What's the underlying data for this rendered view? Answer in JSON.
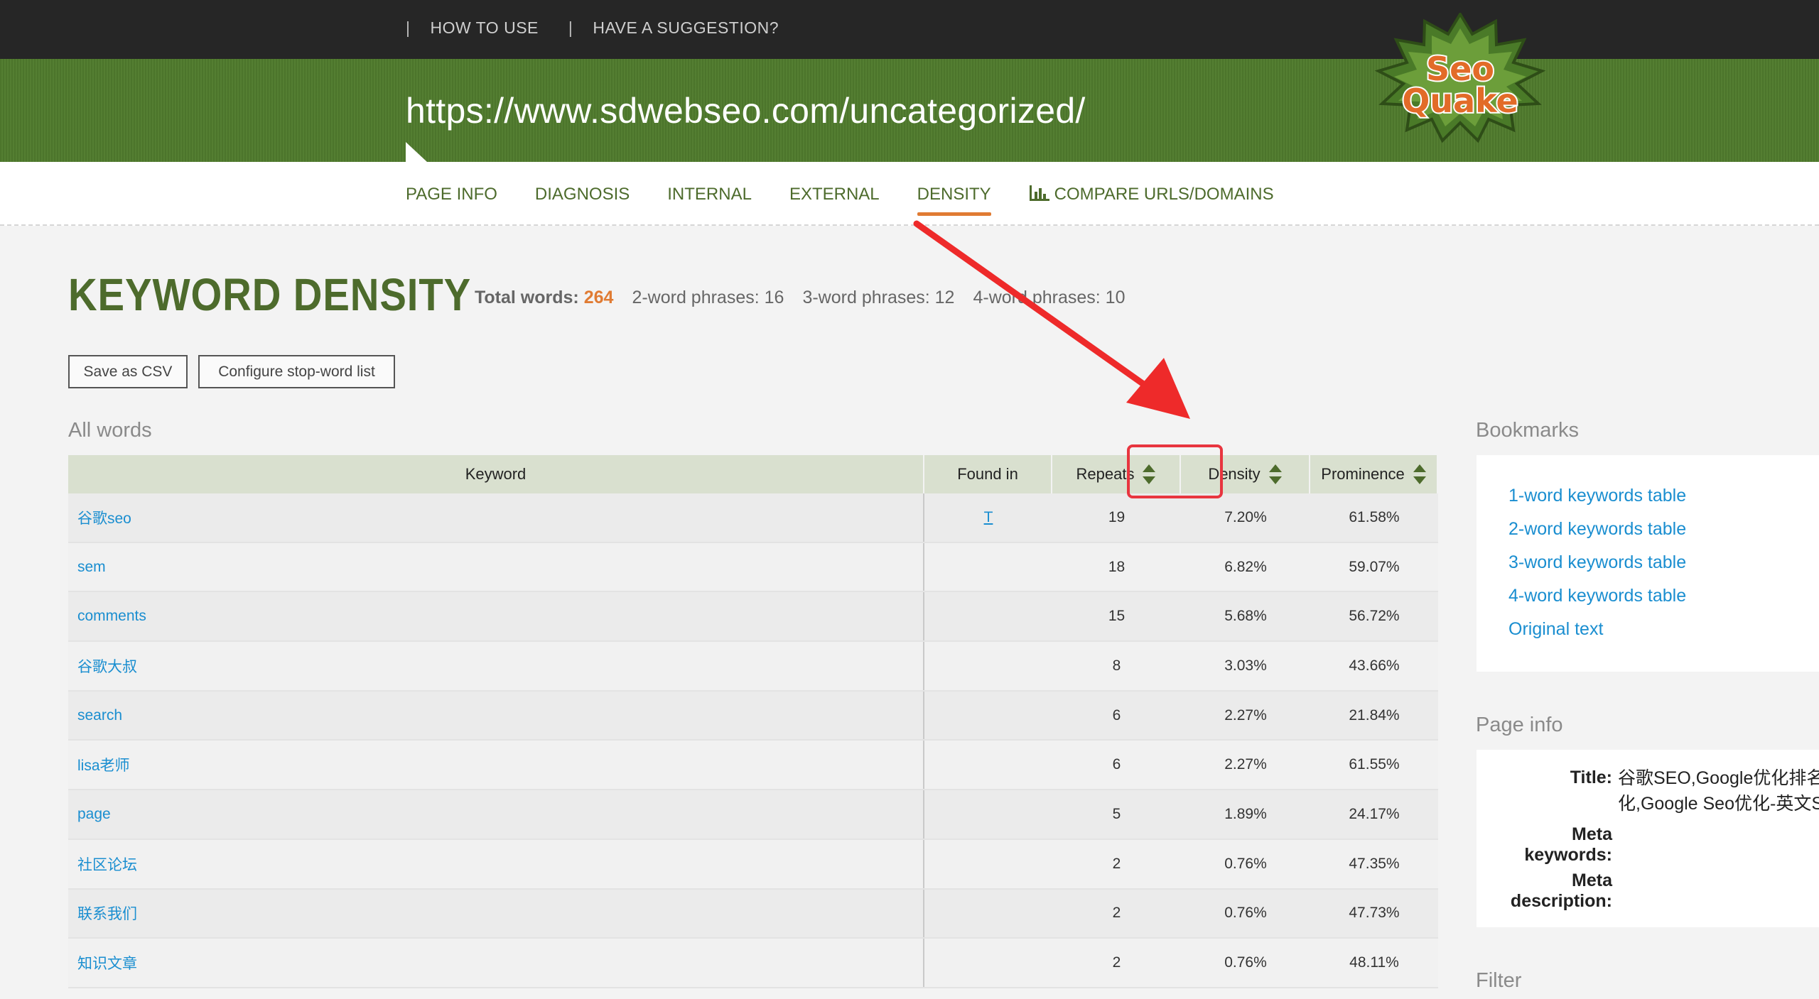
{
  "topnav": {
    "sep": "|",
    "how_to_use": "HOW TO USE",
    "suggestion": "HAVE A SUGGESTION?"
  },
  "banner": {
    "url": "https://www.sdwebseo.com/uncategorized/"
  },
  "logo": {
    "line1": "Seo",
    "line2": "Quake",
    "icon": "seoquake-logo"
  },
  "tabs": [
    "PAGE INFO",
    "DIAGNOSIS",
    "INTERNAL",
    "EXTERNAL",
    "DENSITY",
    "COMPARE URLS/DOMAINS"
  ],
  "active_tab": "DENSITY",
  "heading": "KEYWORD DENSITY",
  "stats": {
    "total_label": "Total words:",
    "total_value": "264",
    "two_word": "2-word phrases: 16",
    "three_word": "3-word phrases: 12",
    "four_word": "4-word phrases: 10"
  },
  "buttons": {
    "save_csv": "Save as CSV",
    "configure": "Configure stop-word list"
  },
  "all_words_title": "All words",
  "table": {
    "headers": {
      "keyword": "Keyword",
      "found_in": "Found in",
      "repeats": "Repeats",
      "density": "Density",
      "prominence": "Prominence"
    },
    "rows": [
      {
        "keyword": "谷歌seo",
        "found": "T",
        "repeats": "19",
        "density": "7.20%",
        "prominence": "61.58%"
      },
      {
        "keyword": "sem",
        "found": "",
        "repeats": "18",
        "density": "6.82%",
        "prominence": "59.07%"
      },
      {
        "keyword": "comments",
        "found": "",
        "repeats": "15",
        "density": "5.68%",
        "prominence": "56.72%"
      },
      {
        "keyword": "谷歌大叔",
        "found": "",
        "repeats": "8",
        "density": "3.03%",
        "prominence": "43.66%"
      },
      {
        "keyword": "search",
        "found": "",
        "repeats": "6",
        "density": "2.27%",
        "prominence": "21.84%"
      },
      {
        "keyword": "lisa老师",
        "found": "",
        "repeats": "6",
        "density": "2.27%",
        "prominence": "61.55%"
      },
      {
        "keyword": "page",
        "found": "",
        "repeats": "5",
        "density": "1.89%",
        "prominence": "24.17%"
      },
      {
        "keyword": "社区论坛",
        "found": "",
        "repeats": "2",
        "density": "0.76%",
        "prominence": "47.35%"
      },
      {
        "keyword": "联系我们",
        "found": "",
        "repeats": "2",
        "density": "0.76%",
        "prominence": "47.73%"
      },
      {
        "keyword": "知识文章",
        "found": "",
        "repeats": "2",
        "density": "0.76%",
        "prominence": "48.11%"
      }
    ]
  },
  "bookmarks": {
    "title": "Bookmarks",
    "links": [
      "1-word keywords table",
      "2-word keywords table",
      "3-word keywords table",
      "4-word keywords table",
      "Original text"
    ]
  },
  "page_info": {
    "title": "Page info",
    "title_label": "Title:",
    "title_value_1": "谷歌SEO,Google优化排名",
    "title_value_2": "化,Google Seo优化-英文S",
    "meta_kw_label_1": "Meta",
    "meta_kw_label_2": "keywords:",
    "meta_desc_label_1": "Meta",
    "meta_desc_label_2": "description:"
  },
  "filter_title": "Filter",
  "colors": {
    "green": "#517c2e",
    "orange": "#e07b33",
    "link": "#1a8ed0",
    "highlight": "#e8353f"
  }
}
